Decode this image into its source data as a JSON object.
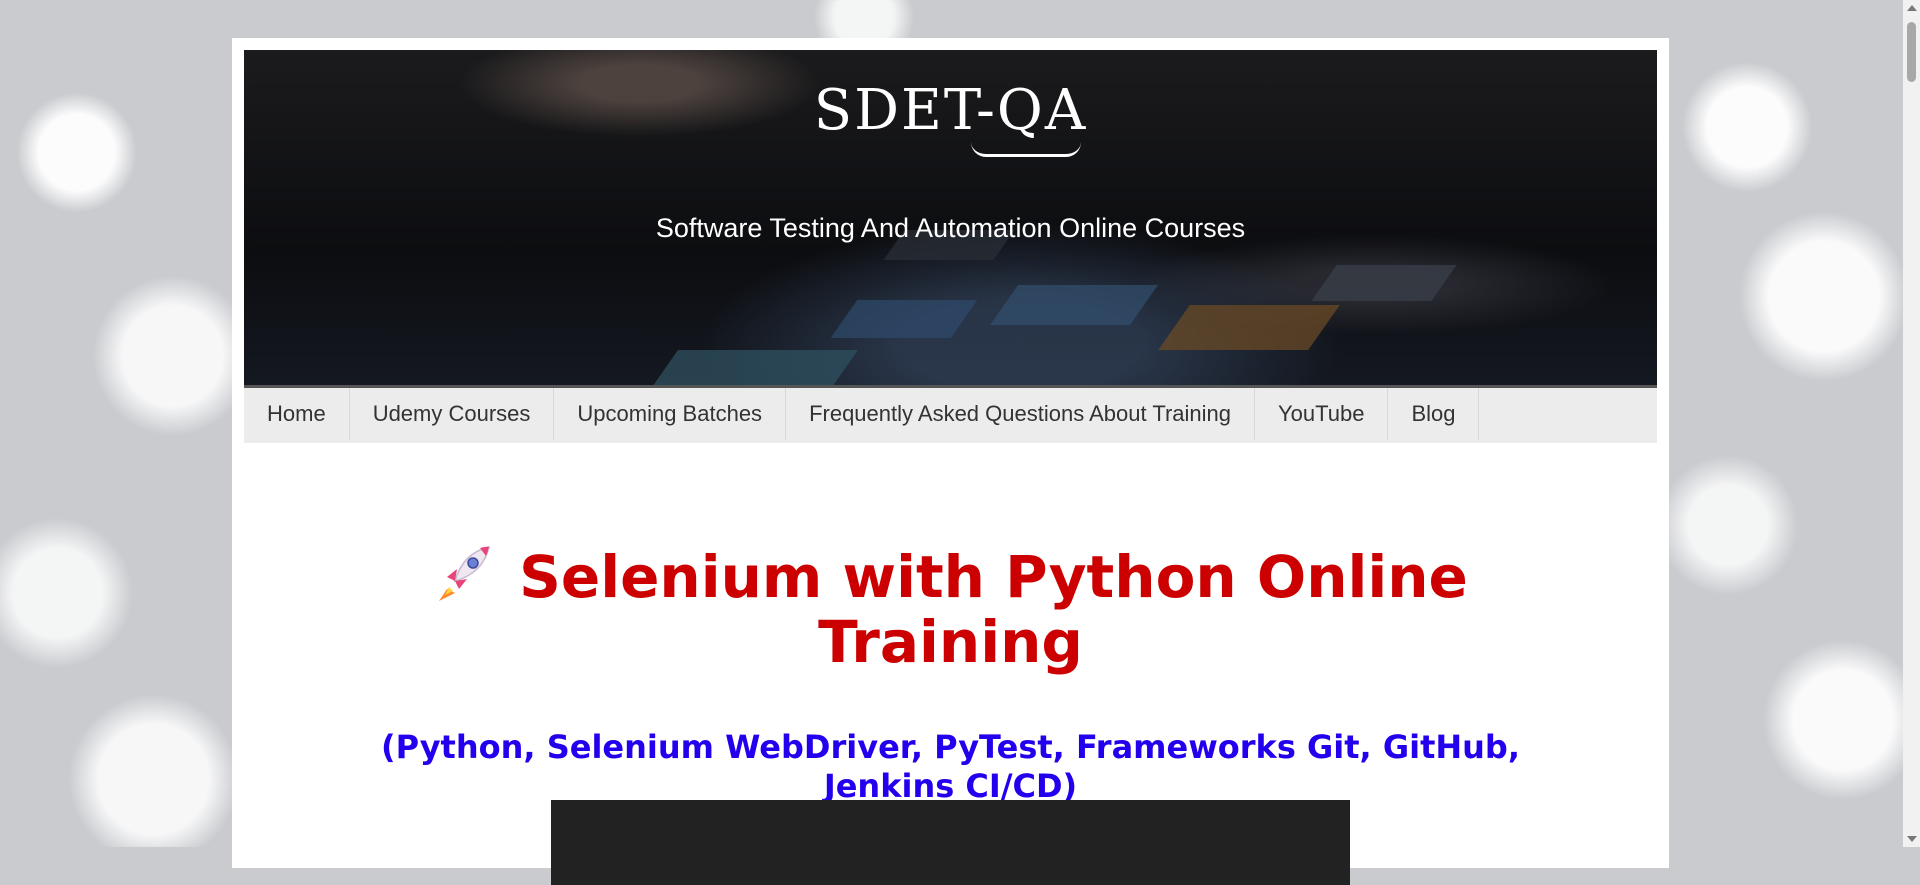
{
  "header": {
    "logo_text": "SDET-QA",
    "tagline": "Software Testing And Automation Online Courses"
  },
  "nav": {
    "items": [
      {
        "label": "Home"
      },
      {
        "label": "Udemy Courses"
      },
      {
        "label": "Upcoming Batches"
      },
      {
        "label": "Frequently Asked Questions About Training"
      },
      {
        "label": "YouTube"
      },
      {
        "label": "Blog"
      }
    ]
  },
  "hero": {
    "icon": "rocket-icon",
    "title_line1": "Selenium with Python Online",
    "title_line2": "Training",
    "subtitle_line1": "(Python, Selenium WebDriver, PyTest, Frameworks Git, GitHub,",
    "subtitle_line2": "Jenkins CI/CD)"
  },
  "colors": {
    "title": "#cc0000",
    "subtitle": "#2200ee",
    "nav_bg": "#ececec"
  }
}
